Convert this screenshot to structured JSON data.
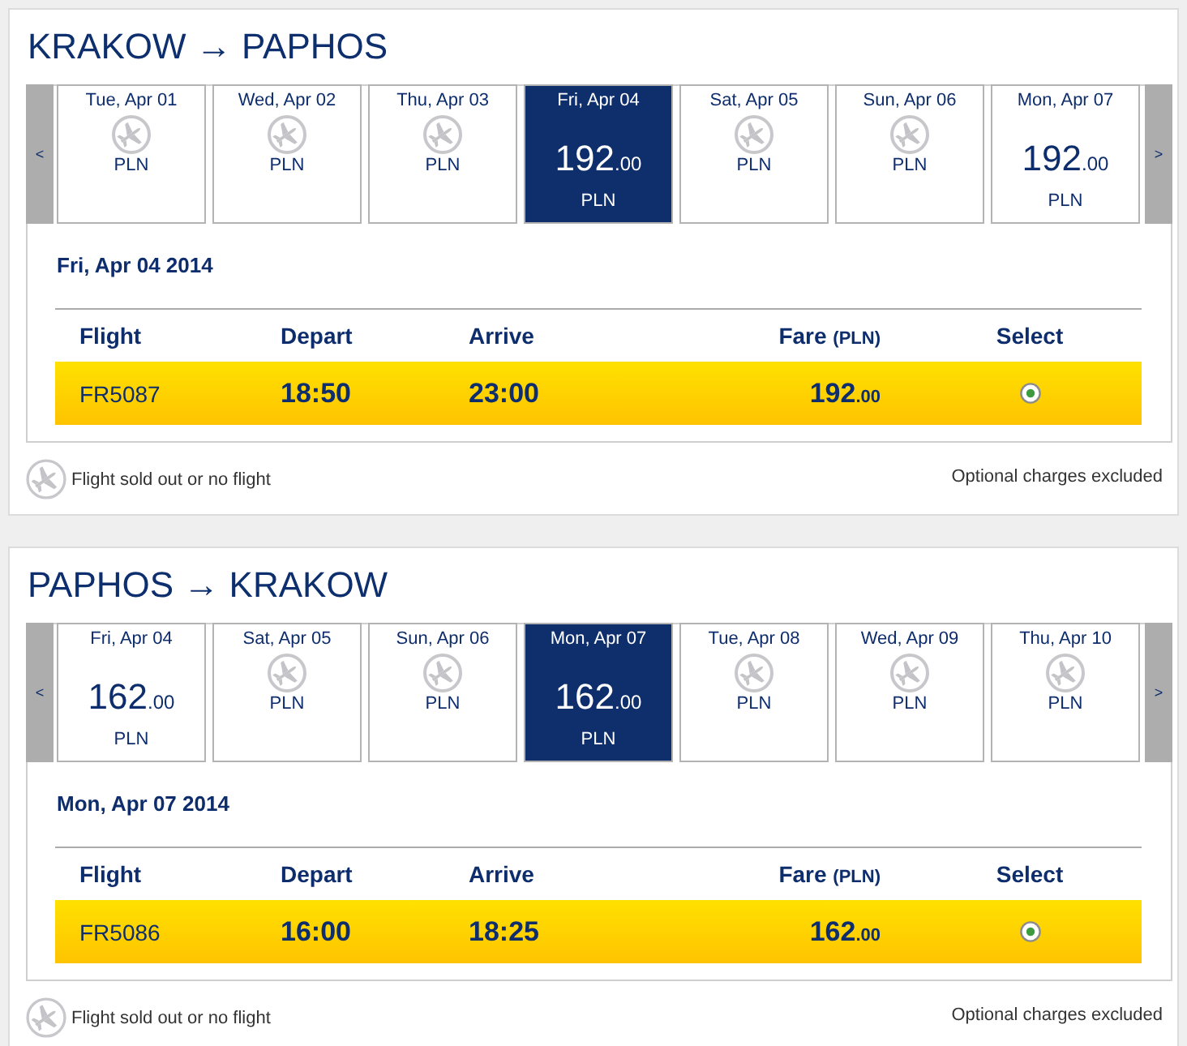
{
  "journeys": [
    {
      "title": "KRAKOW → PAPHOS",
      "prev": "<",
      "next": ">",
      "dates": [
        {
          "label": "Tue, Apr 01",
          "kind": "sold_out",
          "currency": "PLN",
          "selected": false
        },
        {
          "label": "Wed, Apr 02",
          "kind": "sold_out",
          "currency": "PLN",
          "selected": false
        },
        {
          "label": "Thu, Apr 03",
          "kind": "sold_out",
          "currency": "PLN",
          "selected": false
        },
        {
          "label": "Fri, Apr 04",
          "kind": "fare",
          "amount": "192",
          "decimals": ".00",
          "currency": "PLN",
          "selected": true
        },
        {
          "label": "Sat, Apr 05",
          "kind": "sold_out",
          "currency": "PLN",
          "selected": false
        },
        {
          "label": "Sun, Apr 06",
          "kind": "sold_out",
          "currency": "PLN",
          "selected": false
        },
        {
          "label": "Mon, Apr 07",
          "kind": "fare",
          "amount": "192",
          "decimals": ".00",
          "currency": "PLN",
          "selected": false
        }
      ],
      "selected_date": "Fri, Apr 04 2014",
      "columns": [
        {
          "label": "Flight"
        },
        {
          "label": "Depart"
        },
        {
          "label": "Arrive"
        },
        {
          "label": "Fare",
          "unit": "(PLN)"
        },
        {
          "label": "Select"
        }
      ],
      "rows": [
        {
          "flight": "FR5087",
          "depart": "18:50",
          "arrive": "23:00",
          "fare": "192",
          "fare_decimals": ".00",
          "selected": true
        }
      ],
      "legend": "Flight sold out or no flight",
      "note": "Optional charges excluded"
    },
    {
      "title": "PAPHOS → KRAKOW",
      "prev": "<",
      "next": ">",
      "dates": [
        {
          "label": "Fri, Apr 04",
          "kind": "fare",
          "amount": "162",
          "decimals": ".00",
          "currency": "PLN",
          "selected": false
        },
        {
          "label": "Sat, Apr 05",
          "kind": "sold_out",
          "currency": "PLN",
          "selected": false
        },
        {
          "label": "Sun, Apr 06",
          "kind": "sold_out",
          "currency": "PLN",
          "selected": false
        },
        {
          "label": "Mon, Apr 07",
          "kind": "fare",
          "amount": "162",
          "decimals": ".00",
          "currency": "PLN",
          "selected": true
        },
        {
          "label": "Tue, Apr 08",
          "kind": "sold_out",
          "currency": "PLN",
          "selected": false
        },
        {
          "label": "Wed, Apr 09",
          "kind": "sold_out",
          "currency": "PLN",
          "selected": false
        },
        {
          "label": "Thu, Apr 10",
          "kind": "sold_out",
          "currency": "PLN",
          "selected": false
        }
      ],
      "selected_date": "Mon, Apr 07 2014",
      "columns": [
        {
          "label": "Flight"
        },
        {
          "label": "Depart"
        },
        {
          "label": "Arrive"
        },
        {
          "label": "Fare",
          "unit": "(PLN)"
        },
        {
          "label": "Select"
        }
      ],
      "rows": [
        {
          "flight": "FR5086",
          "depart": "16:00",
          "arrive": "18:25",
          "fare": "162",
          "fare_decimals": ".00",
          "selected": true
        }
      ],
      "legend": "Flight sold out or no flight",
      "note": "Optional charges excluded"
    }
  ]
}
